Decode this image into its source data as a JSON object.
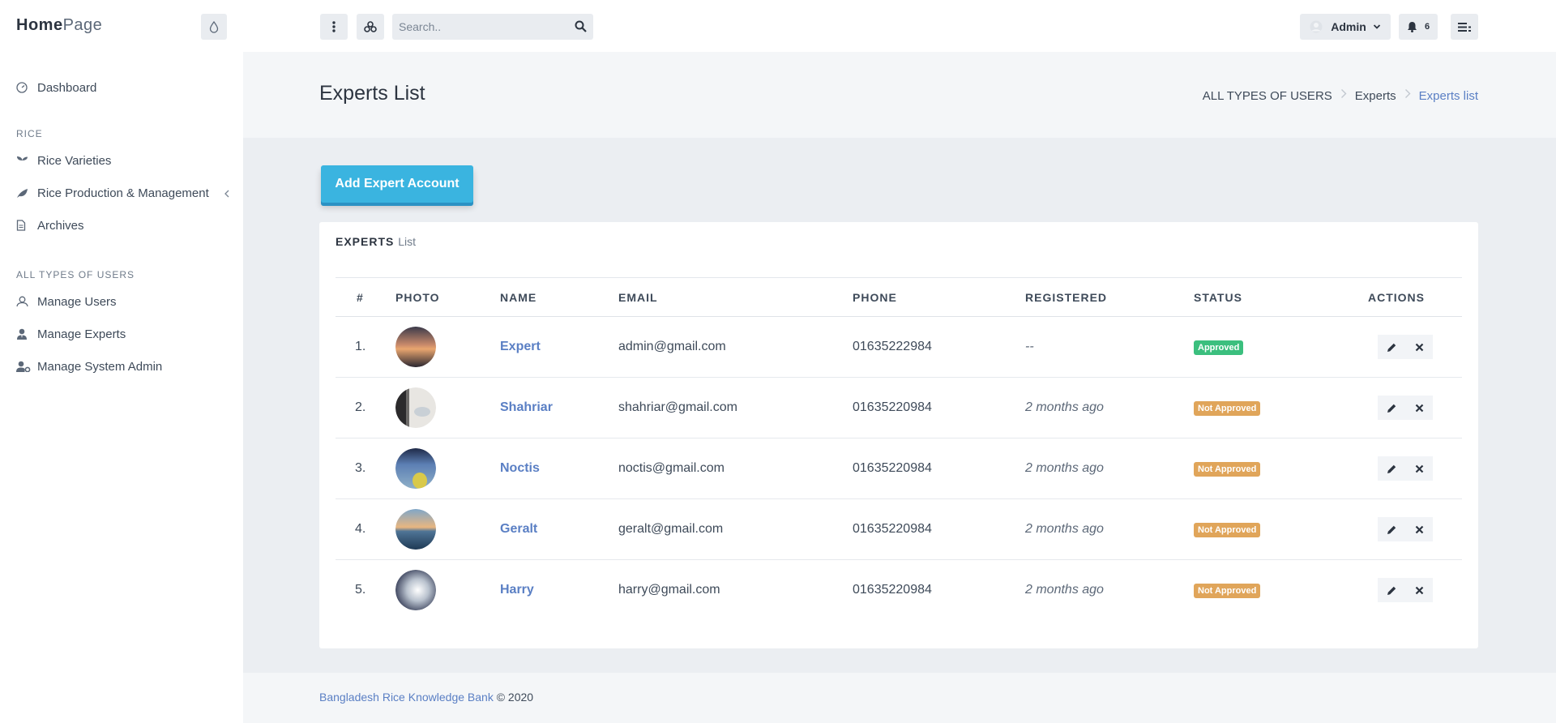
{
  "brand": {
    "bold": "Home",
    "light": "Page"
  },
  "sidebar": {
    "items": [
      {
        "label": "Dashboard",
        "icon": "dashboard-icon"
      }
    ],
    "sections": [
      {
        "heading": "RICE",
        "items": [
          {
            "label": "Rice Varieties",
            "icon": "seedling-icon"
          },
          {
            "label": "Rice Production & Management",
            "icon": "leaf-icon",
            "expandable": true
          },
          {
            "label": "Archives",
            "icon": "file-icon"
          }
        ]
      },
      {
        "heading": "ALL TYPES OF USERS",
        "items": [
          {
            "label": "Manage Users",
            "icon": "user-icon"
          },
          {
            "label": "Manage Experts",
            "icon": "user-tie-icon"
          },
          {
            "label": "Manage System Admin",
            "icon": "user-cog-icon"
          }
        ]
      }
    ]
  },
  "topbar": {
    "search_placeholder": "Search..",
    "user_label": "Admin",
    "notification_count": "6"
  },
  "page": {
    "title": "Experts List",
    "breadcrumb": [
      "ALL TYPES OF USERS",
      "Experts",
      "Experts list"
    ]
  },
  "main": {
    "add_button_label": "Add Expert Account",
    "card_title_bold": "EXPERTS",
    "card_title_light": "List"
  },
  "table": {
    "headers": [
      "#",
      "PHOTO",
      "NAME",
      "EMAIL",
      "PHONE",
      "REGISTERED",
      "STATUS",
      "ACTIONS"
    ],
    "rows": [
      {
        "num": "1.",
        "name": "Expert",
        "email": "admin@gmail.com",
        "phone": "01635222984",
        "registered": "--",
        "status": "Approved"
      },
      {
        "num": "2.",
        "name": "Shahriar",
        "email": "shahriar@gmail.com",
        "phone": "01635220984",
        "registered": "2 months ago",
        "status": "Not Approved"
      },
      {
        "num": "3.",
        "name": "Noctis",
        "email": "noctis@gmail.com",
        "phone": "01635220984",
        "registered": "2 months ago",
        "status": "Not Approved"
      },
      {
        "num": "4.",
        "name": "Geralt",
        "email": "geralt@gmail.com",
        "phone": "01635220984",
        "registered": "2 months ago",
        "status": "Not Approved"
      },
      {
        "num": "5.",
        "name": "Harry",
        "email": "harry@gmail.com",
        "phone": "01635220984",
        "registered": "2 months ago",
        "status": "Not Approved"
      }
    ]
  },
  "footer": {
    "org": "Bangladesh Rice Knowledge Bank",
    "copyright": "© 2020"
  },
  "colors": {
    "accent": "#5a7fc4",
    "add_button": "#3ab4e0",
    "approved": "#3bbf7e",
    "not_approved": "#e0a55a"
  }
}
